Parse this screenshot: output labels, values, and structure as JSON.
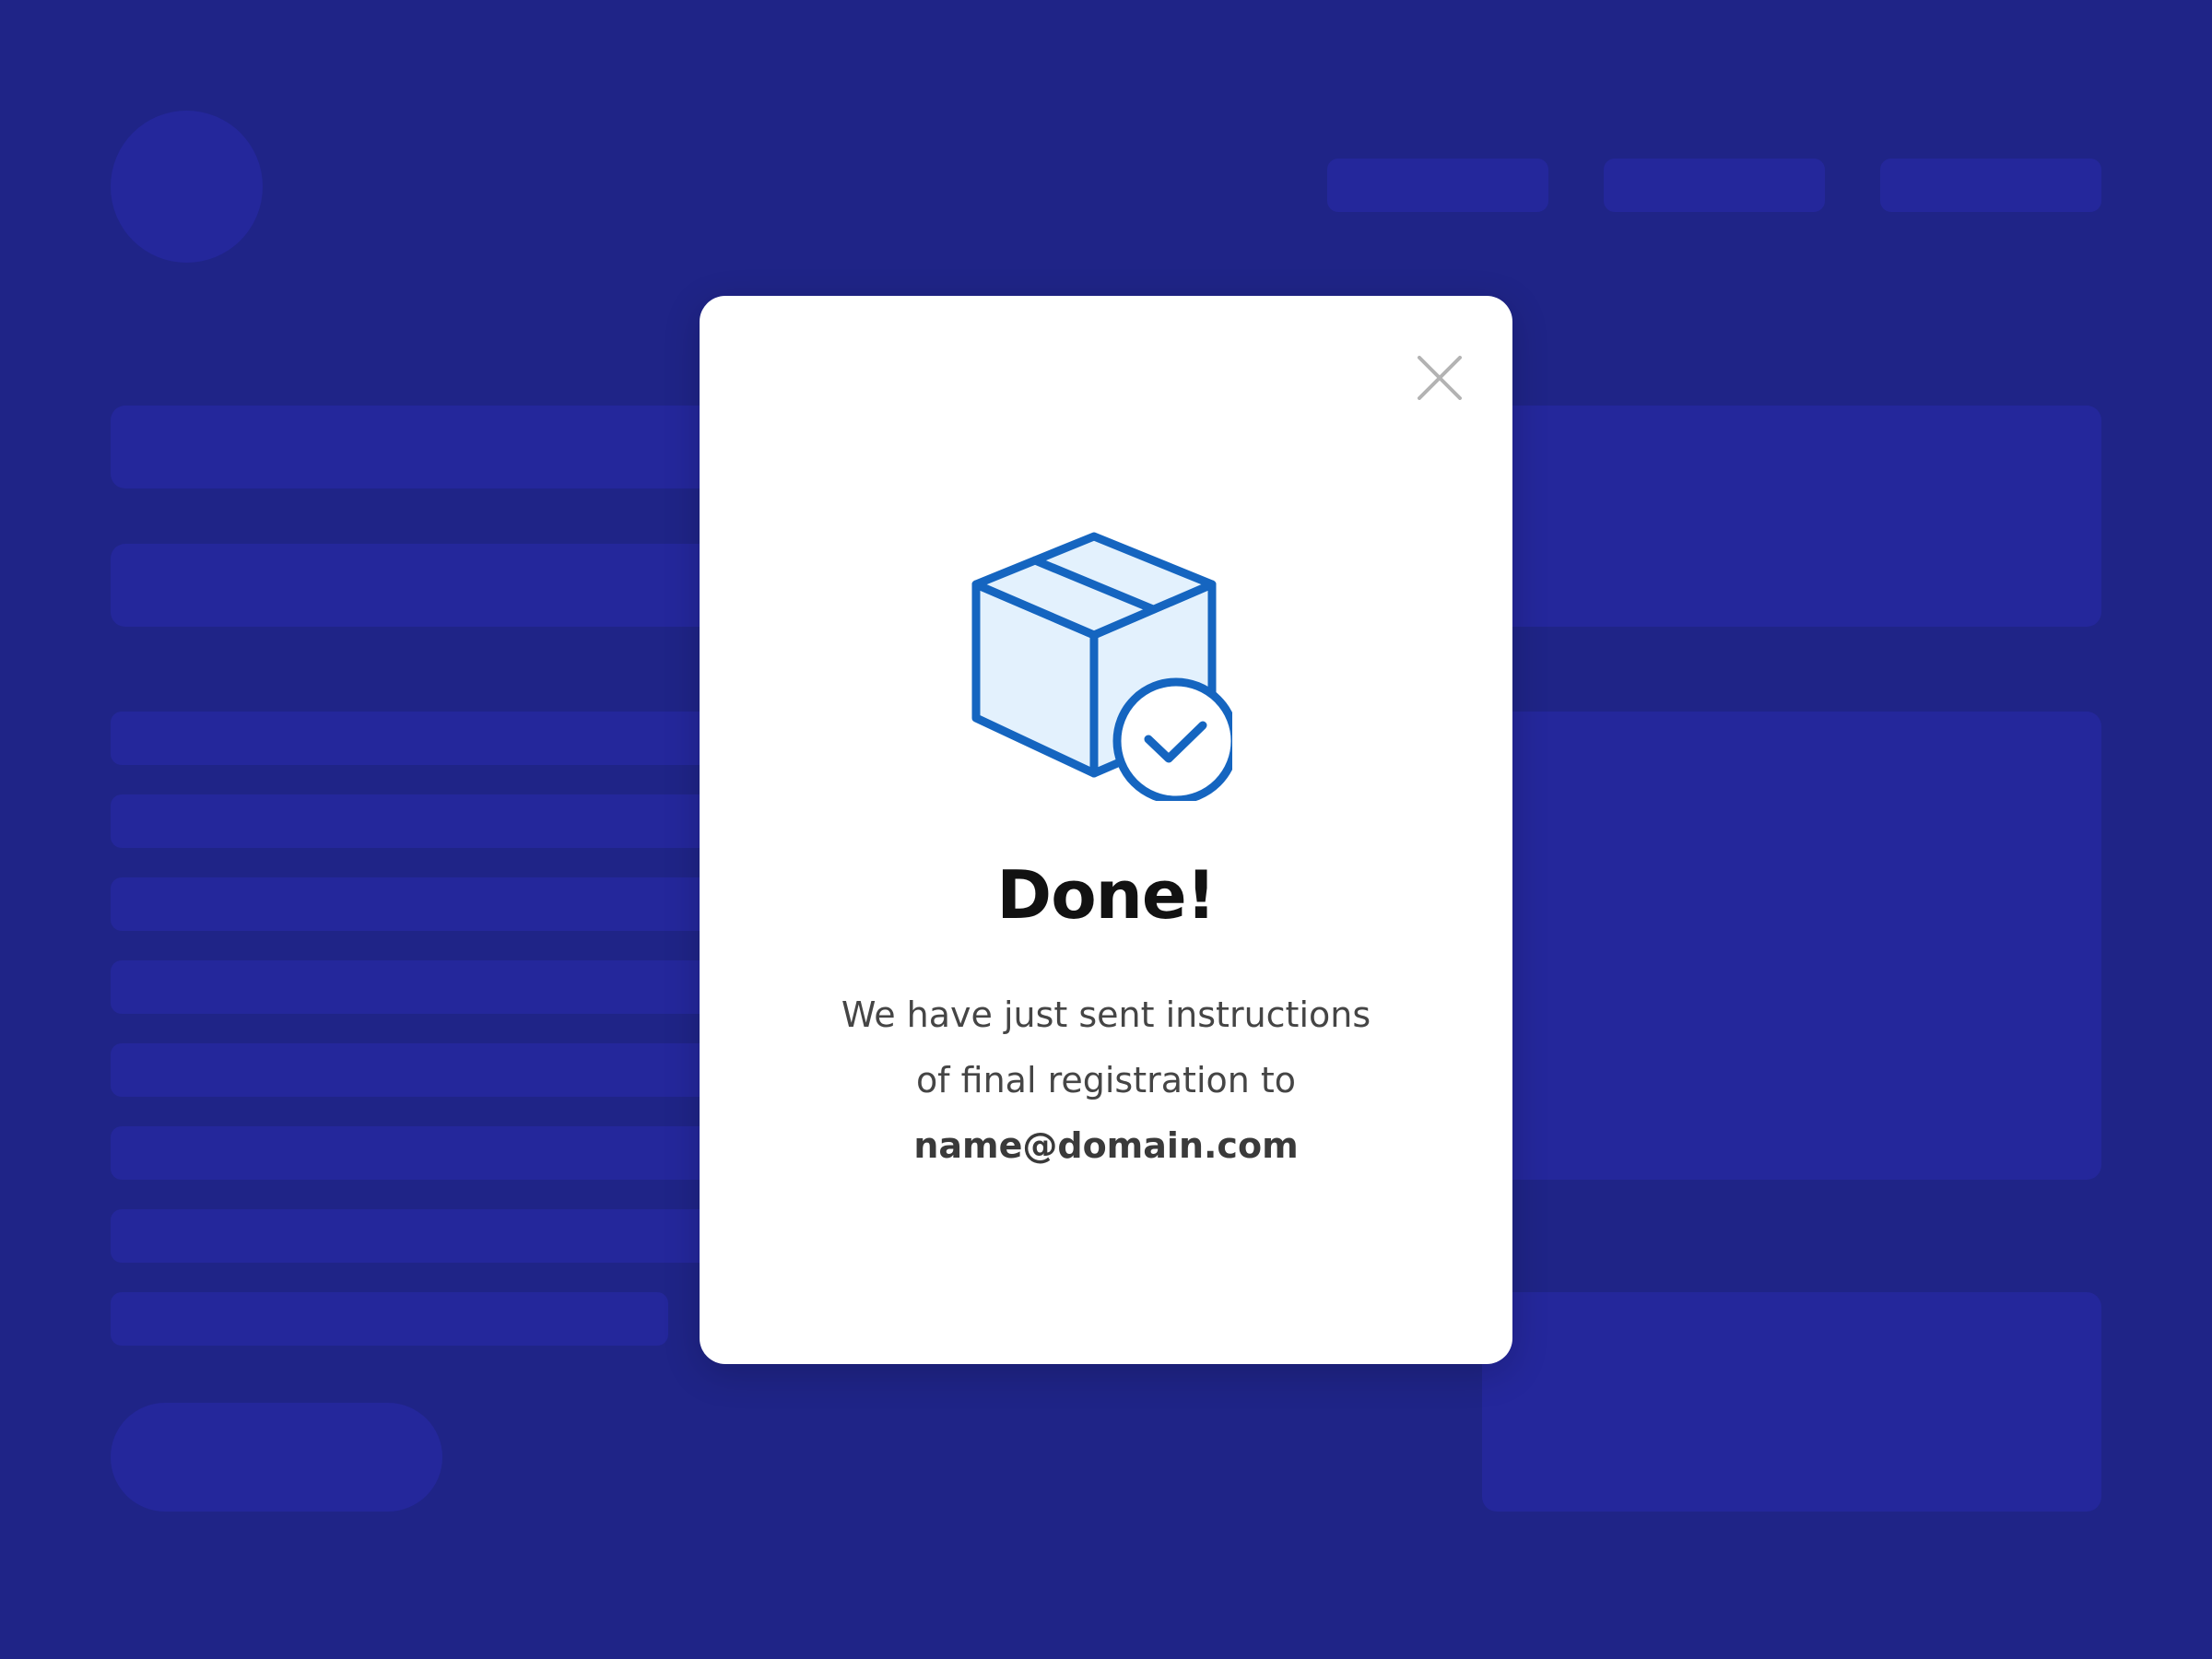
{
  "modal": {
    "title": "Done!",
    "message_line1": "We have just sent instructions",
    "message_line2": "of final registration to",
    "email": "name@domain.com",
    "close_icon": "close-icon",
    "illustration_icon": "package-check-icon"
  },
  "colors": {
    "background": "#1f2487",
    "placeholder": "#24279b",
    "accent": "#1565c0",
    "icon_fill": "#e3f1fd"
  }
}
